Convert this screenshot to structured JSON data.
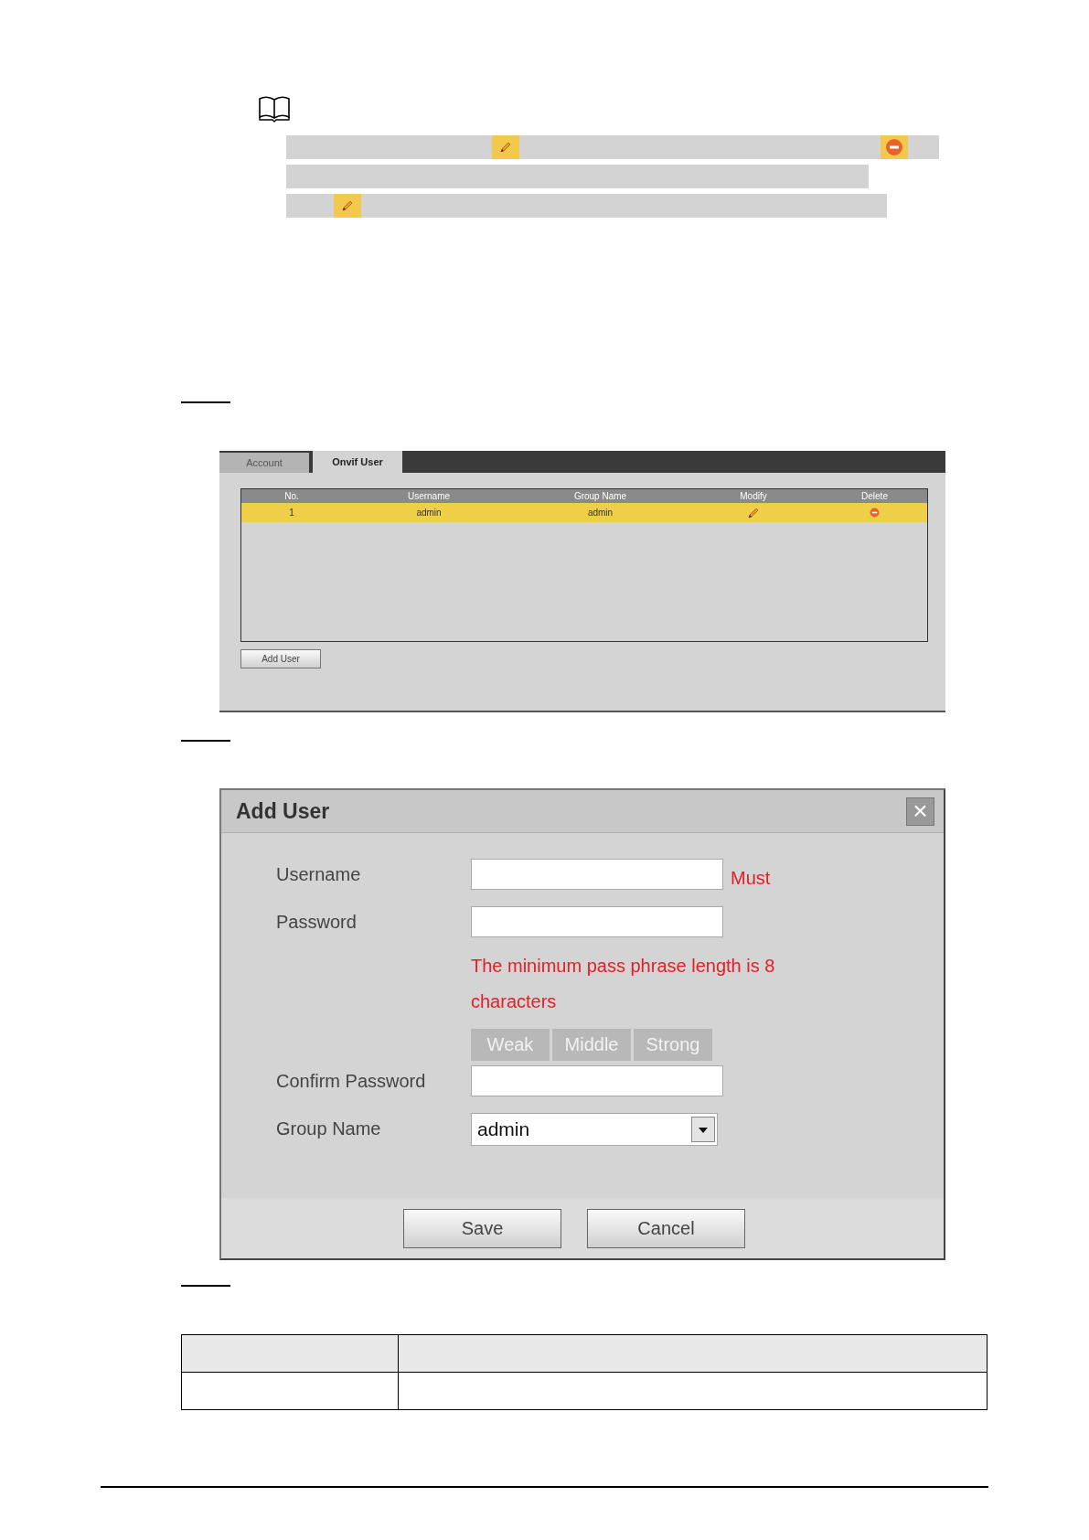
{
  "note": {
    "lines": [
      {
        "segments": [
          {
            "kind": "text"
          },
          {
            "kind": "edit"
          },
          {
            "kind": "text"
          },
          {
            "kind": "delete"
          },
          {
            "kind": "text"
          }
        ]
      },
      {
        "segments": [
          {
            "kind": "text"
          }
        ]
      },
      {
        "segments": [
          {
            "kind": "text"
          },
          {
            "kind": "edit"
          },
          {
            "kind": "text"
          }
        ]
      }
    ]
  },
  "account_screen": {
    "tabs": [
      {
        "label": "Account",
        "selected": false
      },
      {
        "label": "Onvif User",
        "selected": true
      }
    ],
    "table": {
      "columns": [
        "No.",
        "Username",
        "Group Name",
        "Modify",
        "Delete"
      ],
      "rows": [
        {
          "no": "1",
          "username": "admin",
          "group_name": "admin",
          "selected": true
        }
      ]
    },
    "add_button": "Add User"
  },
  "add_user_dialog": {
    "title": "Add User",
    "close": "×",
    "fields": [
      {
        "kind": "input",
        "label": "Username",
        "hint": "Must"
      },
      {
        "kind": "input",
        "label": "Password",
        "hint": "The minimum pass phrase length is 8 characters"
      },
      {
        "kind": "strength",
        "levels": [
          "Weak",
          "Middle",
          "Strong"
        ]
      },
      {
        "kind": "input",
        "label": "Confirm Password"
      },
      {
        "kind": "select",
        "label": "Group Name",
        "value": "admin"
      }
    ],
    "buttons": [
      "Save",
      "Cancel"
    ]
  }
}
